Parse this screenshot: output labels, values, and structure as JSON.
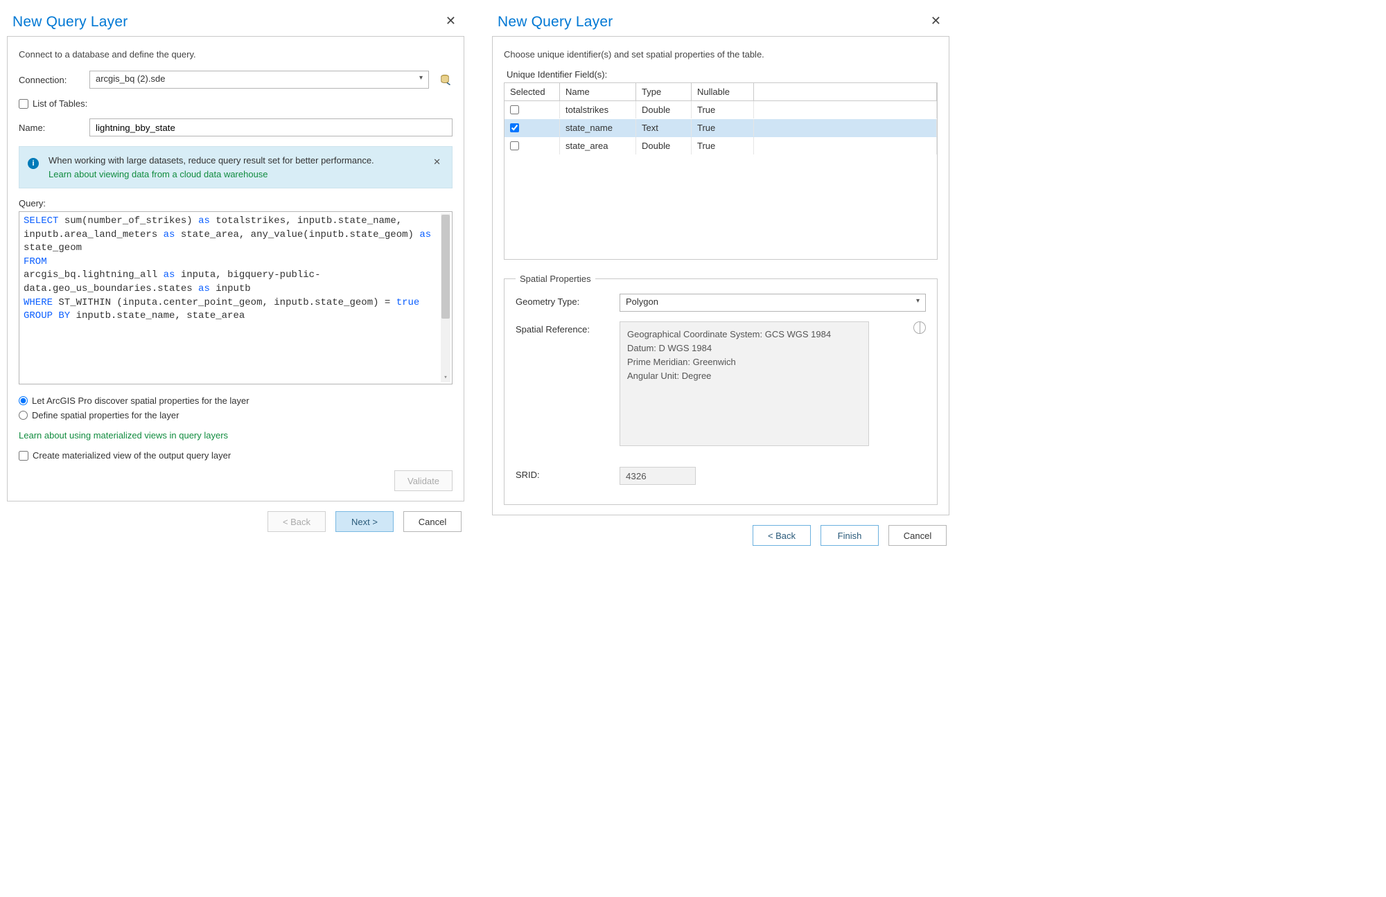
{
  "left": {
    "title": "New Query Layer",
    "intro": "Connect to a database and define the query.",
    "connection_label": "Connection:",
    "connection_value": "arcgis_bq (2).sde",
    "list_tables_label": "List of Tables:",
    "name_label": "Name:",
    "name_value": "lightning_bby_state",
    "info_line1": "When working with large datasets, reduce query result set for better performance.",
    "info_link": "Learn about viewing data from a cloud data warehouse",
    "query_label": "Query:",
    "query_tokens": [
      {
        "t": "SELECT",
        "kw": true
      },
      {
        "t": " sum(number_of_strikes) "
      },
      {
        "t": "as",
        "kw": true
      },
      {
        "t": " totalstrikes, inputb.state_name, inputb.area_land_meters "
      },
      {
        "t": "as",
        "kw": true
      },
      {
        "t": " state_area, any_value(inputb.state_geom) "
      },
      {
        "t": "as",
        "kw": true
      },
      {
        "t": " state_geom"
      },
      {
        "t": "\n"
      },
      {
        "t": "FROM",
        "kw": true
      },
      {
        "t": "\n"
      },
      {
        "t": "arcgis_bq.lightning_all "
      },
      {
        "t": "as",
        "kw": true
      },
      {
        "t": " inputa, bigquery-public-data.geo_us_boundaries.states "
      },
      {
        "t": "as",
        "kw": true
      },
      {
        "t": " inputb"
      },
      {
        "t": "\n"
      },
      {
        "t": "WHERE",
        "kw": true
      },
      {
        "t": " ST_WITHIN (inputa.center_point_geom, inputb.state_geom) = "
      },
      {
        "t": "true",
        "kw": true
      },
      {
        "t": "\n"
      },
      {
        "t": "GROUP BY",
        "kw": true
      },
      {
        "t": " inputb.state_name, state_area"
      }
    ],
    "radio_discover": "Let ArcGIS Pro discover spatial properties for the layer",
    "radio_define": "Define spatial properties for the layer",
    "mview_link": "Learn about using materialized views in query layers",
    "mview_chk": "Create materialized view of the output query layer",
    "validate_btn": "Validate",
    "back_btn": "< Back",
    "next_btn": "Next >",
    "cancel_btn": "Cancel"
  },
  "right": {
    "title": "New Query Layer",
    "intro": "Choose unique identifier(s) and set spatial properties of the table.",
    "uid_label": "Unique Identifier Field(s):",
    "cols": {
      "selected": "Selected",
      "name": "Name",
      "type": "Type",
      "nullable": "Nullable"
    },
    "rows": [
      {
        "selected": false,
        "name": "totalstrikes",
        "type": "Double",
        "nullable": "True"
      },
      {
        "selected": true,
        "name": "state_name",
        "type": "Text",
        "nullable": "True"
      },
      {
        "selected": false,
        "name": "state_area",
        "type": "Double",
        "nullable": "True"
      }
    ],
    "spatial_legend": "Spatial Properties",
    "geom_label": "Geometry Type:",
    "geom_value": "Polygon",
    "sref_label": "Spatial Reference:",
    "sref_lines": [
      "Geographical Coordinate System:  GCS WGS 1984",
      "Datum:  D WGS 1984",
      "Prime Meridian:  Greenwich",
      "Angular Unit:  Degree"
    ],
    "srid_label": "SRID:",
    "srid_value": "4326",
    "back_btn": "< Back",
    "finish_btn": "Finish",
    "cancel_btn": "Cancel"
  }
}
